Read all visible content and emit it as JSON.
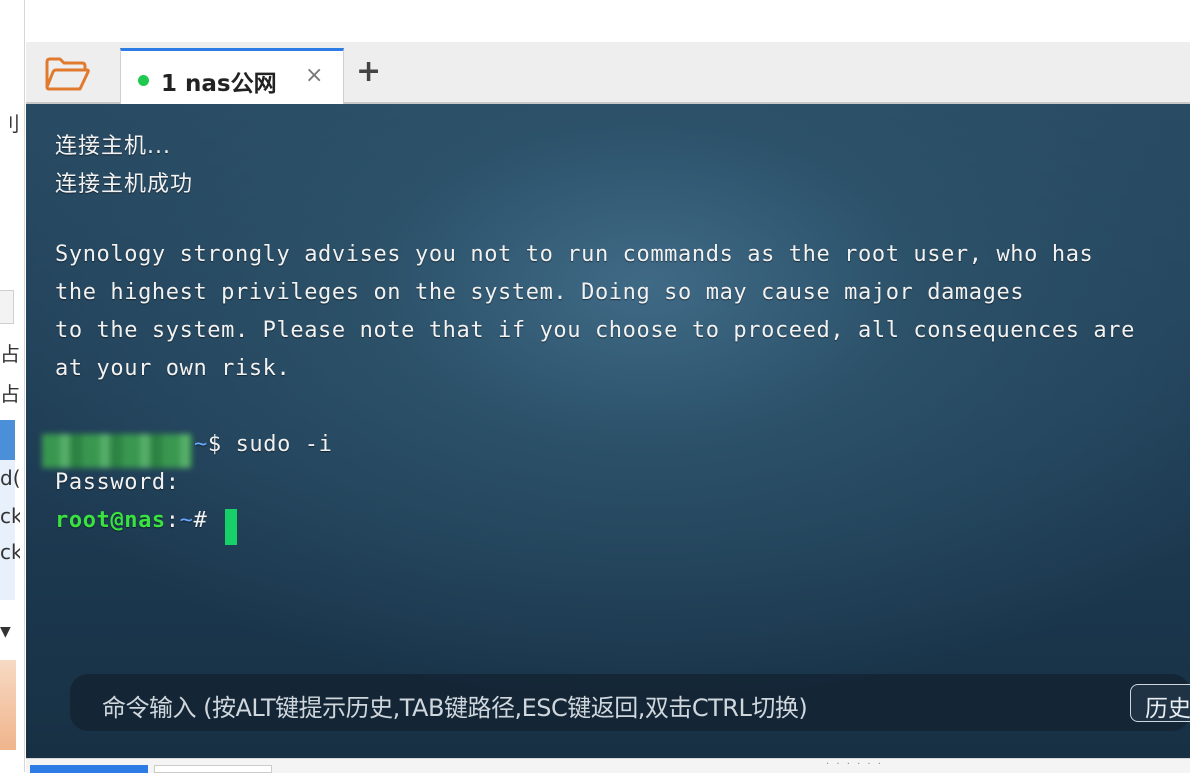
{
  "tabs": [
    {
      "label": "1 nas公网",
      "status": "connected",
      "status_color": "#1fc94f"
    }
  ],
  "tab_close": "×",
  "add_tab": "+",
  "icons": {
    "folder": "folder-open-icon",
    "close": "close-icon",
    "add": "plus-icon"
  },
  "terminal": {
    "lines": [
      "连接主机...",
      "连接主机成功",
      "Synology strongly advises you not to run commands as the root user, who has",
      "the highest privileges on the system. Doing so may cause major damages",
      "to the system. Please note that if you choose to proceed, all consequences are",
      "at your own risk."
    ],
    "prompt1_suffix": "~",
    "prompt1_dollar": "$ ",
    "command1": "sudo -i",
    "password_line": "Password:",
    "root_user": "root@nas",
    "root_colon": ":",
    "root_path": "~",
    "root_hash": "# "
  },
  "cmd_bar": {
    "placeholder": "命令输入 (按ALT键提示历史,TAB键路径,ESC键返回,双击CTRL切换)",
    "history_button": "历史"
  },
  "left_strip": {
    "fragments": [
      "刂",
      "占",
      "占",
      "d(",
      "ck",
      "ck",
      "▼"
    ]
  },
  "colors": {
    "accent": "#2d7be5",
    "prompt_green": "#39e23f",
    "prompt_blue": "#6aa7ff",
    "cursor": "#17d06a"
  }
}
